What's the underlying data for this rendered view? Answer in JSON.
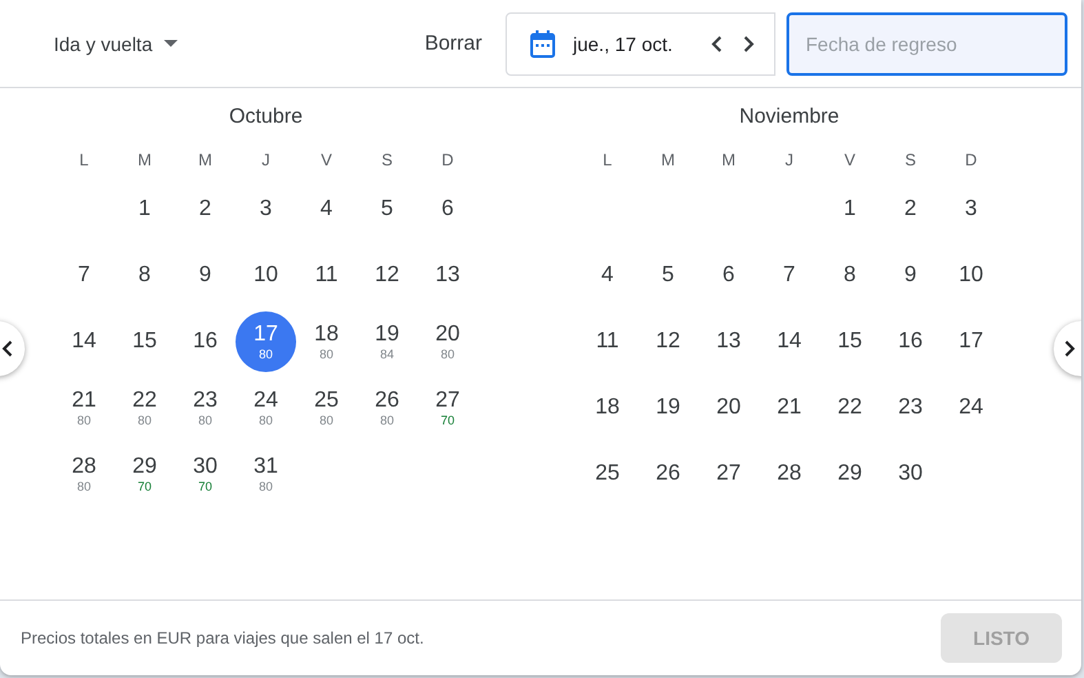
{
  "trip_type": {
    "label": "Ida y vuelta"
  },
  "clear_button": "Borrar",
  "departure_field": {
    "value": "jue., 17 oct."
  },
  "return_field": {
    "placeholder": "Fecha de regreso",
    "focused": true
  },
  "months": [
    {
      "name": "Octubre",
      "weekdays": [
        "L",
        "M",
        "M",
        "J",
        "V",
        "S",
        "D"
      ],
      "weeks": [
        [
          {
            "day": "1",
            "selected": false
          },
          {
            "day": "2",
            "selected": false
          },
          {
            "day": "3",
            "selected": false
          },
          {
            "day": "4",
            "selected": false
          },
          {
            "day": "5",
            "selected": false
          },
          {
            "day": "6",
            "selected": false
          }
        ],
        [
          {
            "day": "7",
            "selected": false
          },
          {
            "day": "8",
            "selected": false
          },
          {
            "day": "9",
            "selected": false
          },
          {
            "day": "10",
            "selected": false
          },
          {
            "day": "11",
            "selected": false
          },
          {
            "day": "12",
            "selected": false
          },
          {
            "day": "13",
            "selected": false
          }
        ],
        [
          {
            "day": "14",
            "selected": false
          },
          {
            "day": "15",
            "selected": false
          },
          {
            "day": "16",
            "selected": false
          },
          {
            "day": "17",
            "selected": true,
            "price": "80",
            "low": false
          },
          {
            "day": "18",
            "selected": false,
            "price": "80",
            "low": false
          },
          {
            "day": "19",
            "selected": false,
            "price": "84",
            "low": false
          },
          {
            "day": "20",
            "selected": false,
            "price": "80",
            "low": false
          }
        ],
        [
          {
            "day": "21",
            "selected": false,
            "price": "80",
            "low": false
          },
          {
            "day": "22",
            "selected": false,
            "price": "80",
            "low": false
          },
          {
            "day": "23",
            "selected": false,
            "price": "80",
            "low": false
          },
          {
            "day": "24",
            "selected": false,
            "price": "80",
            "low": false
          },
          {
            "day": "25",
            "selected": false,
            "price": "80",
            "low": false
          },
          {
            "day": "26",
            "selected": false,
            "price": "80",
            "low": false
          },
          {
            "day": "27",
            "selected": false,
            "price": "70",
            "low": true
          }
        ],
        [
          {
            "day": "28",
            "selected": false,
            "price": "80",
            "low": false
          },
          {
            "day": "29",
            "selected": false,
            "price": "70",
            "low": true
          },
          {
            "day": "30",
            "selected": false,
            "price": "70",
            "low": true
          },
          {
            "day": "31",
            "selected": false,
            "price": "80",
            "low": false
          }
        ]
      ]
    },
    {
      "name": "Noviembre",
      "weekdays": [
        "L",
        "M",
        "M",
        "J",
        "V",
        "S",
        "D"
      ],
      "weeks": [
        [
          {
            "day": "1",
            "selected": false
          },
          {
            "day": "2",
            "selected": false
          },
          {
            "day": "3",
            "selected": false
          }
        ],
        [
          {
            "day": "4",
            "selected": false
          },
          {
            "day": "5",
            "selected": false
          },
          {
            "day": "6",
            "selected": false
          },
          {
            "day": "7",
            "selected": false
          },
          {
            "day": "8",
            "selected": false
          },
          {
            "day": "9",
            "selected": false
          },
          {
            "day": "10",
            "selected": false
          }
        ],
        [
          {
            "day": "11",
            "selected": false
          },
          {
            "day": "12",
            "selected": false
          },
          {
            "day": "13",
            "selected": false
          },
          {
            "day": "14",
            "selected": false
          },
          {
            "day": "15",
            "selected": false
          },
          {
            "day": "16",
            "selected": false
          },
          {
            "day": "17",
            "selected": false
          }
        ],
        [
          {
            "day": "18",
            "selected": false
          },
          {
            "day": "19",
            "selected": false
          },
          {
            "day": "20",
            "selected": false
          },
          {
            "day": "21",
            "selected": false
          },
          {
            "day": "22",
            "selected": false
          },
          {
            "day": "23",
            "selected": false
          },
          {
            "day": "24",
            "selected": false
          }
        ],
        [
          {
            "day": "25",
            "selected": false
          },
          {
            "day": "26",
            "selected": false
          },
          {
            "day": "27",
            "selected": false
          },
          {
            "day": "28",
            "selected": false
          },
          {
            "day": "29",
            "selected": false
          },
          {
            "day": "30",
            "selected": false
          }
        ]
      ]
    }
  ],
  "footer_note": "Precios totales en EUR para viajes que salen el 17 oct.",
  "done_button": {
    "label": "LISTO",
    "disabled": true
  }
}
